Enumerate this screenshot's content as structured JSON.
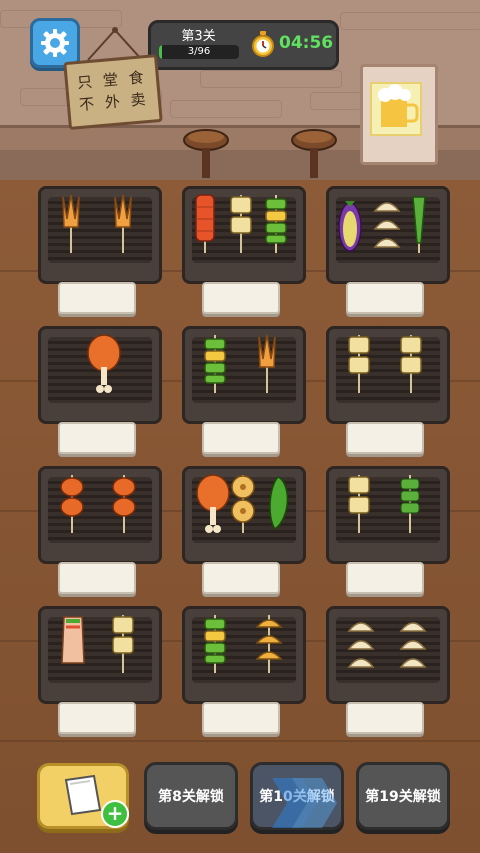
{
  "hud": {
    "level": "第3关",
    "progress_text": "3/96",
    "progress_value": 0.03125,
    "timer": "04:56"
  },
  "sign": {
    "line1": "只 堂 食",
    "line2": "不 外 卖"
  },
  "grills": [
    {
      "id": "g1",
      "items": [
        "chicken-feet",
        "chicken-feet"
      ]
    },
    {
      "id": "g2",
      "items": [
        "sausage",
        "tofu-skewer",
        "green-pepper-skewer"
      ]
    },
    {
      "id": "g3",
      "items": [
        "eggplant",
        "dumpling",
        "okra"
      ]
    },
    {
      "id": "g4",
      "items": [
        "drumstick"
      ]
    },
    {
      "id": "g5",
      "items": [
        "green-pepper-skewer",
        "chicken-feet"
      ]
    },
    {
      "id": "g6",
      "items": [
        "tofu-skewer",
        "tofu-skewer"
      ]
    },
    {
      "id": "g7",
      "items": [
        "chicken-wing",
        "chicken-wing"
      ]
    },
    {
      "id": "g8",
      "items": [
        "drumstick",
        "lotus-root",
        "green-chili"
      ]
    },
    {
      "id": "g9",
      "items": [
        "tofu-skewer",
        "okra-skewer"
      ]
    },
    {
      "id": "g10",
      "items": [
        "wrap",
        "tofu-skewer"
      ]
    },
    {
      "id": "g11",
      "items": [
        "green-pepper-skewer",
        "dumpling-skewer"
      ]
    },
    {
      "id": "g12",
      "items": [
        "dumpling",
        "dumpling"
      ]
    }
  ],
  "bottom": {
    "unlock_8": "第8关解锁",
    "unlock_10": "第10关解锁",
    "unlock_19": "第19关解锁"
  },
  "colors": {
    "accent_green": "#5fe25f",
    "button_blue": "#4aa7e6",
    "menu_yellow": "#f3d066"
  },
  "icons": [
    "gear-icon",
    "stopwatch-icon",
    "menu-card-icon",
    "plus-icon",
    "lock-icon"
  ]
}
